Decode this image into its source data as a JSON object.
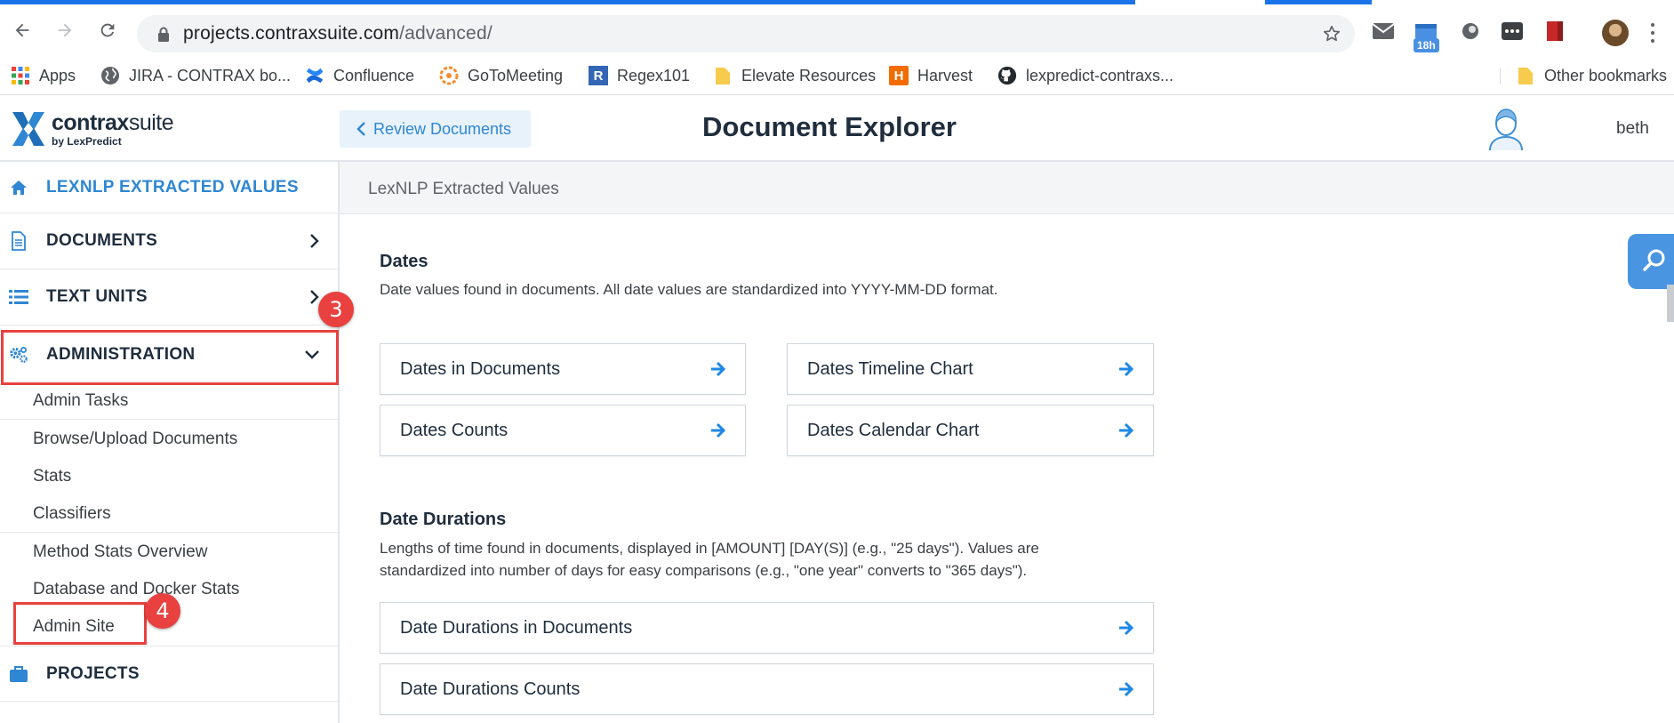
{
  "browser": {
    "url_host": "projects.contraxsuite.com",
    "url_path": "/advanced/",
    "extension_badge": "18h",
    "bookmarks": [
      {
        "label": "Apps",
        "icon": "apps-grid-icon"
      },
      {
        "label": "JIRA - CONTRAX bo...",
        "icon": "globe-icon"
      },
      {
        "label": "Confluence",
        "icon": "confluence-icon"
      },
      {
        "label": "GoToMeeting",
        "icon": "gotomeeting-icon"
      },
      {
        "label": "Regex101",
        "icon": "regex-icon"
      },
      {
        "label": "Elevate Resources",
        "icon": "folder-icon"
      },
      {
        "label": "Harvest",
        "icon": "harvest-icon"
      },
      {
        "label": "lexpredict-contraxs...",
        "icon": "github-icon"
      },
      {
        "label": "Other bookmarks",
        "icon": "folder-icon"
      }
    ],
    "regex_icon_letter": "R",
    "harvest_icon_letter": "H"
  },
  "header": {
    "logo_name_bold": "contrax",
    "logo_name_light": "suite",
    "logo_byline": "by LexPredict",
    "back_button_label": "Review Documents",
    "title": "Document Explorer",
    "username": "beth"
  },
  "sidebar": {
    "items": [
      {
        "label": "LEXNLP EXTRACTED VALUES"
      },
      {
        "label": "DOCUMENTS"
      },
      {
        "label": "TEXT UNITS"
      },
      {
        "label": "ADMINISTRATION"
      },
      {
        "label": "PROJECTS"
      }
    ],
    "admin_subitems": [
      {
        "label": "Admin Tasks"
      },
      {
        "label": "Browse/Upload Documents"
      },
      {
        "label": "Stats"
      },
      {
        "label": "Classifiers"
      },
      {
        "label": "Method Stats Overview"
      },
      {
        "label": "Database and Docker Stats"
      },
      {
        "label": "Admin Site"
      }
    ]
  },
  "annotations": {
    "step_3": "3",
    "step_4": "4"
  },
  "main": {
    "breadcrumb": "LexNLP Extracted Values",
    "sections": [
      {
        "title": "Dates",
        "description": "Date values found in documents. All date values are standardized into YYYY-MM-DD format.",
        "cards": [
          {
            "label": "Dates in Documents"
          },
          {
            "label": "Dates Timeline Chart"
          },
          {
            "label": "Dates Counts"
          },
          {
            "label": "Dates Calendar Chart"
          }
        ]
      },
      {
        "title": "Date Durations",
        "description": "Lengths of time found in documents, displayed in [AMOUNT] [DAY(S)] (e.g., \"25 days\"). Values are standardized into number of days for easy comparisons (e.g., \"one year\" converts to \"365 days\").",
        "cards": [
          {
            "label": "Date Durations in Documents"
          },
          {
            "label": "Date Durations Counts"
          }
        ]
      }
    ]
  },
  "colors": {
    "accent": "#2f87d3",
    "annotation": "#e8413f",
    "arrow": "#1e88e5",
    "navy": "#1f2d3d"
  }
}
